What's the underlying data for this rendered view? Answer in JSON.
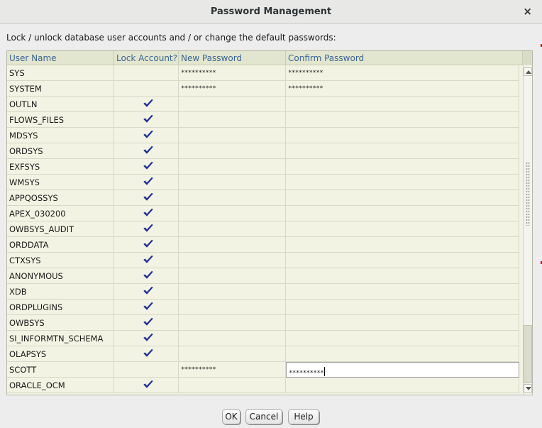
{
  "window": {
    "title": "Password Management",
    "close_glyph": "×"
  },
  "instructions": "Lock / unlock database user accounts and / or change the default passwords:",
  "table": {
    "columns": [
      "User Name",
      "Lock Account?",
      "New Password",
      "Confirm Password"
    ],
    "rows": [
      {
        "user": "SYS",
        "locked": false,
        "new_password": "**********",
        "confirm_password": "**********"
      },
      {
        "user": "SYSTEM",
        "locked": false,
        "new_password": "**********",
        "confirm_password": "**********"
      },
      {
        "user": "OUTLN",
        "locked": true,
        "new_password": "",
        "confirm_password": ""
      },
      {
        "user": "FLOWS_FILES",
        "locked": true,
        "new_password": "",
        "confirm_password": ""
      },
      {
        "user": "MDSYS",
        "locked": true,
        "new_password": "",
        "confirm_password": ""
      },
      {
        "user": "ORDSYS",
        "locked": true,
        "new_password": "",
        "confirm_password": ""
      },
      {
        "user": "EXFSYS",
        "locked": true,
        "new_password": "",
        "confirm_password": ""
      },
      {
        "user": "WMSYS",
        "locked": true,
        "new_password": "",
        "confirm_password": ""
      },
      {
        "user": "APPQOSSYS",
        "locked": true,
        "new_password": "",
        "confirm_password": ""
      },
      {
        "user": "APEX_030200",
        "locked": true,
        "new_password": "",
        "confirm_password": ""
      },
      {
        "user": "OWBSYS_AUDIT",
        "locked": true,
        "new_password": "",
        "confirm_password": ""
      },
      {
        "user": "ORDDATA",
        "locked": true,
        "new_password": "",
        "confirm_password": ""
      },
      {
        "user": "CTXSYS",
        "locked": true,
        "new_password": "",
        "confirm_password": ""
      },
      {
        "user": "ANONYMOUS",
        "locked": true,
        "new_password": "",
        "confirm_password": ""
      },
      {
        "user": "XDB",
        "locked": true,
        "new_password": "",
        "confirm_password": ""
      },
      {
        "user": "ORDPLUGINS",
        "locked": true,
        "new_password": "",
        "confirm_password": ""
      },
      {
        "user": "OWBSYS",
        "locked": true,
        "new_password": "",
        "confirm_password": ""
      },
      {
        "user": "SI_INFORMTN_SCHEMA",
        "locked": true,
        "new_password": "",
        "confirm_password": ""
      },
      {
        "user": "OLAPSYS",
        "locked": true,
        "new_password": "",
        "confirm_password": ""
      },
      {
        "user": "SCOTT",
        "locked": false,
        "new_password": "**********",
        "confirm_password": "**********",
        "editing": true
      },
      {
        "user": "ORACLE_OCM",
        "locked": true,
        "new_password": "",
        "confirm_password": ""
      }
    ]
  },
  "buttons": {
    "ok": "OK",
    "cancel": "Cancel",
    "help": "Help"
  },
  "colors": {
    "header_text": "#3b6594",
    "checkmark": "#1f2f9a",
    "table_bg": "#f3f3e3"
  }
}
